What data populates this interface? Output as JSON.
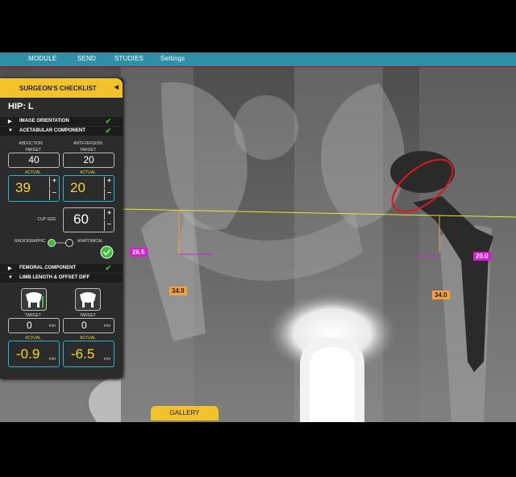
{
  "nav": {
    "items": [
      "MODULE",
      "SEND",
      "STUDIES",
      "Settings"
    ]
  },
  "panel": {
    "title": "SURGEON'S CHECKLIST",
    "collapse_icon": "◀",
    "hip": "HIP: L",
    "sections": {
      "image_orientation": "IMAGE ORIENTATION",
      "acetabular": "ACETABULAR COMPONENT",
      "femoral": "FEMORAL COMPONENT",
      "limb": "LIMB LENGTH & OFFSET DIFF"
    },
    "abduction": {
      "label": "ABDUCTION",
      "target_label": "TARGET",
      "target": "40",
      "actual_label": "ACTUAL",
      "actual": "39"
    },
    "anteversion": {
      "label": "ANTEVERSION",
      "target_label": "TARGET",
      "target": "20",
      "actual_label": "ACTUAL",
      "actual": "20"
    },
    "cup": {
      "label": "CUP SIZE",
      "value": "60"
    },
    "toggle": {
      "left": "RADIOGRAPHIC",
      "right": "ANATOMICAL"
    },
    "limb_length": {
      "target_label": "TARGET",
      "target": "0",
      "unit": "mm",
      "actual_label": "ACTUAL",
      "actual": "-0.9"
    },
    "offset": {
      "target_label": "TARGET",
      "target": "0",
      "unit": "mm",
      "actual_label": "ACTUAL",
      "actual": "-6.5"
    },
    "stepper_plus": "+",
    "stepper_minus": "−",
    "check": "✔"
  },
  "measurements": {
    "left_offset": "26.5",
    "left_length": "34.9",
    "right_length": "34.0",
    "right_offset": "20.0"
  },
  "footer": {
    "gallery": "GALLERY"
  },
  "colors": {
    "accent": "#f2c22b",
    "nav": "#2e8fa6",
    "actual_border": "#26b5d2",
    "actual_text": "#f5d532",
    "check": "#36c136",
    "magenta": "#d81bd8",
    "orange": "#f5a23a",
    "cup_circle": "#e0161a",
    "line": "#e8e826"
  }
}
